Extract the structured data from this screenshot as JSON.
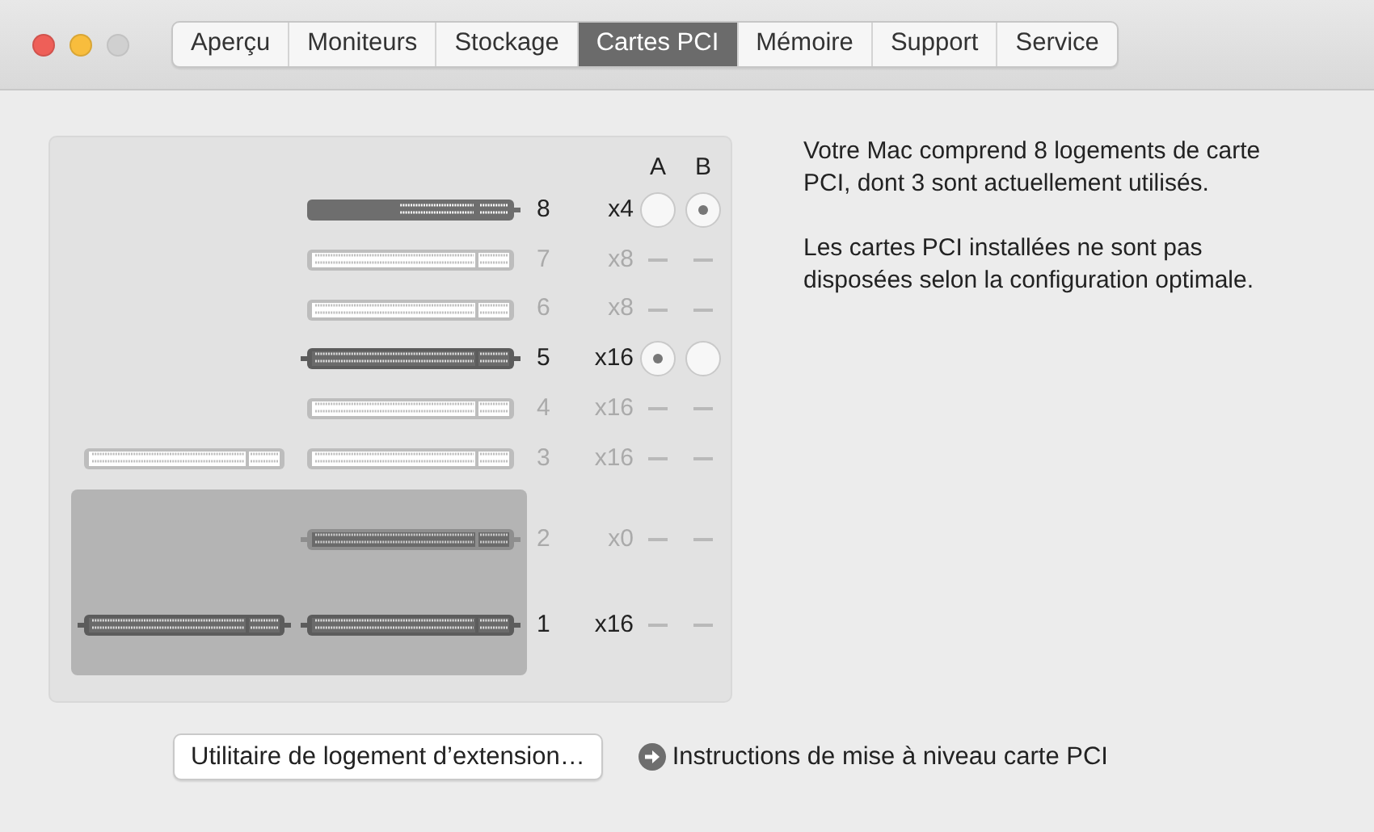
{
  "window": {
    "controls": [
      {
        "kind": "close",
        "disabled": false
      },
      {
        "kind": "minimize",
        "disabled": false
      },
      {
        "kind": "zoom",
        "disabled": true
      }
    ]
  },
  "tabs": [
    {
      "label": "Aperçu",
      "selected": false
    },
    {
      "label": "Moniteurs",
      "selected": false
    },
    {
      "label": "Stockage",
      "selected": false
    },
    {
      "label": "Cartes PCI",
      "selected": true
    },
    {
      "label": "Mémoire",
      "selected": false
    },
    {
      "label": "Support",
      "selected": false
    },
    {
      "label": "Service",
      "selected": false
    }
  ],
  "slots": {
    "columns": [
      "A",
      "B"
    ],
    "rows": [
      {
        "number": "8",
        "lanes": "x4",
        "active": true,
        "slot": {
          "kind": "filled",
          "left_nub": false,
          "right_nub": true
        },
        "a": {
          "kind": "radio",
          "selected": false
        },
        "b": {
          "kind": "radio",
          "selected": true
        }
      },
      {
        "number": "7",
        "lanes": "x8",
        "active": false,
        "slot": {
          "kind": "light",
          "left_nub": false,
          "right_nub": false
        },
        "a": {
          "kind": "dash"
        },
        "b": {
          "kind": "dash"
        }
      },
      {
        "number": "6",
        "lanes": "x8",
        "active": false,
        "slot": {
          "kind": "light",
          "left_nub": false,
          "right_nub": false
        },
        "a": {
          "kind": "dash"
        },
        "b": {
          "kind": "dash"
        }
      },
      {
        "number": "5",
        "lanes": "x16",
        "active": true,
        "slot": {
          "kind": "dark",
          "left_nub": true,
          "right_nub": true
        },
        "a": {
          "kind": "radio",
          "selected": true
        },
        "b": {
          "kind": "radio",
          "selected": false
        }
      },
      {
        "number": "4",
        "lanes": "x16",
        "active": false,
        "slot": {
          "kind": "light",
          "left_nub": false,
          "right_nub": false
        },
        "a": {
          "kind": "dash"
        },
        "b": {
          "kind": "dash"
        }
      },
      {
        "number": "3",
        "lanes": "x16",
        "active": false,
        "slot": {
          "kind": "light",
          "left_nub": false,
          "right_nub": false
        },
        "left_slot": {
          "kind": "light",
          "left_nub": false,
          "right_nub": false
        },
        "a": {
          "kind": "dash"
        },
        "b": {
          "kind": "dash"
        }
      }
    ],
    "bay_rows": [
      {
        "number": "2",
        "lanes": "x0",
        "active": false,
        "slot": {
          "kind": "muted",
          "left_nub": true,
          "right_nub": true
        },
        "a": {
          "kind": "dash"
        },
        "b": {
          "kind": "dash"
        }
      },
      {
        "number": "1",
        "lanes": "x16",
        "active": true,
        "slot": {
          "kind": "dark",
          "left_nub": true,
          "right_nub": true
        },
        "left_slot": {
          "kind": "dark",
          "left_nub": true,
          "right_nub": true
        },
        "a": {
          "kind": "dash"
        },
        "b": {
          "kind": "dash"
        }
      }
    ]
  },
  "info": [
    "Votre Mac comprend 8 logements de carte PCI, dont 3 sont actuellement utilisés.",
    "Les cartes PCI installées ne sont pas disposées selon la configuration optimale."
  ],
  "utility_button": "Utilitaire de logement d’extension…",
  "upgrade_link": "Instructions de mise à niveau carte PCI"
}
